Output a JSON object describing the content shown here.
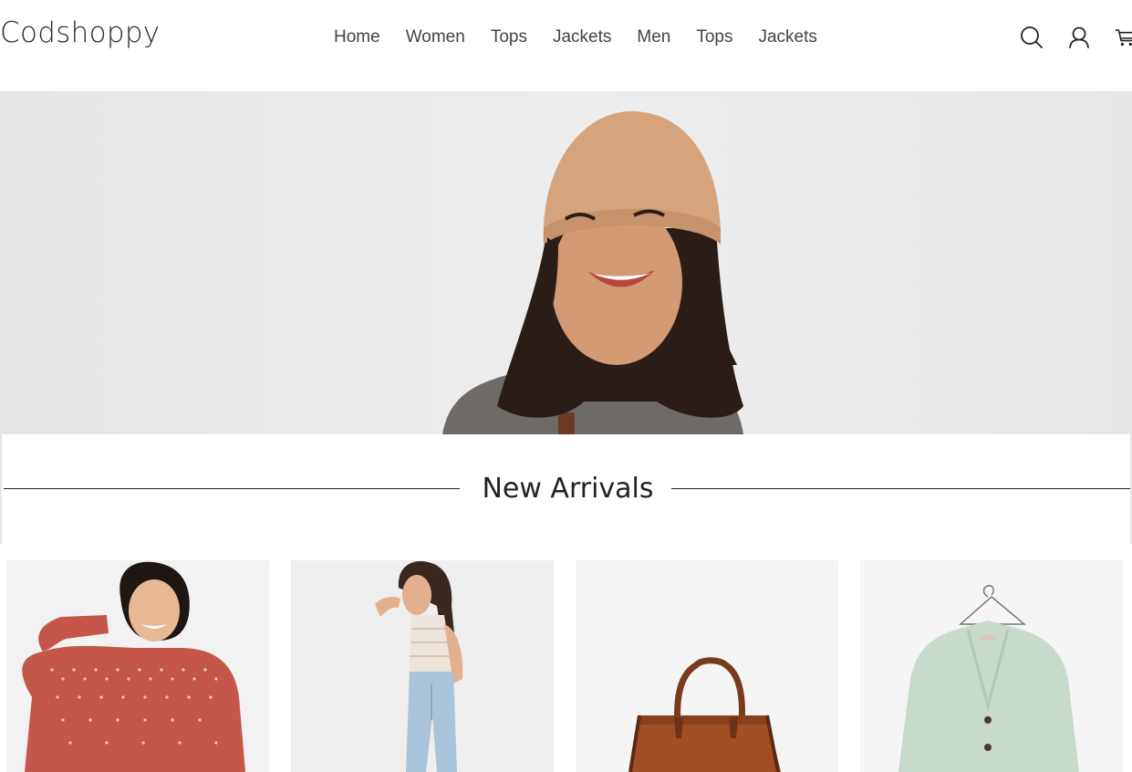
{
  "brand": {
    "name": "Codshoppy"
  },
  "nav": {
    "items": [
      {
        "label": "Home"
      },
      {
        "label": "Women"
      },
      {
        "label": "Tops"
      },
      {
        "label": "Jackets"
      },
      {
        "label": "Men"
      },
      {
        "label": "Tops"
      },
      {
        "label": "Jackets"
      }
    ]
  },
  "header_icons": [
    "search-icon",
    "user-icon",
    "cart-icon"
  ],
  "hero": {
    "image": "woman-in-beanie-smiling"
  },
  "section": {
    "title": "New Arrivals"
  },
  "products": [
    {
      "image": "red-patterned-sweater"
    },
    {
      "image": "striped-tank-jeans"
    },
    {
      "image": "brown-leather-tote"
    },
    {
      "image": "mint-cardigan-on-hanger"
    }
  ],
  "colors": {
    "text": "#333333",
    "hero_bg": "#e9e9e9",
    "card_bg": "#f4f4f4"
  }
}
